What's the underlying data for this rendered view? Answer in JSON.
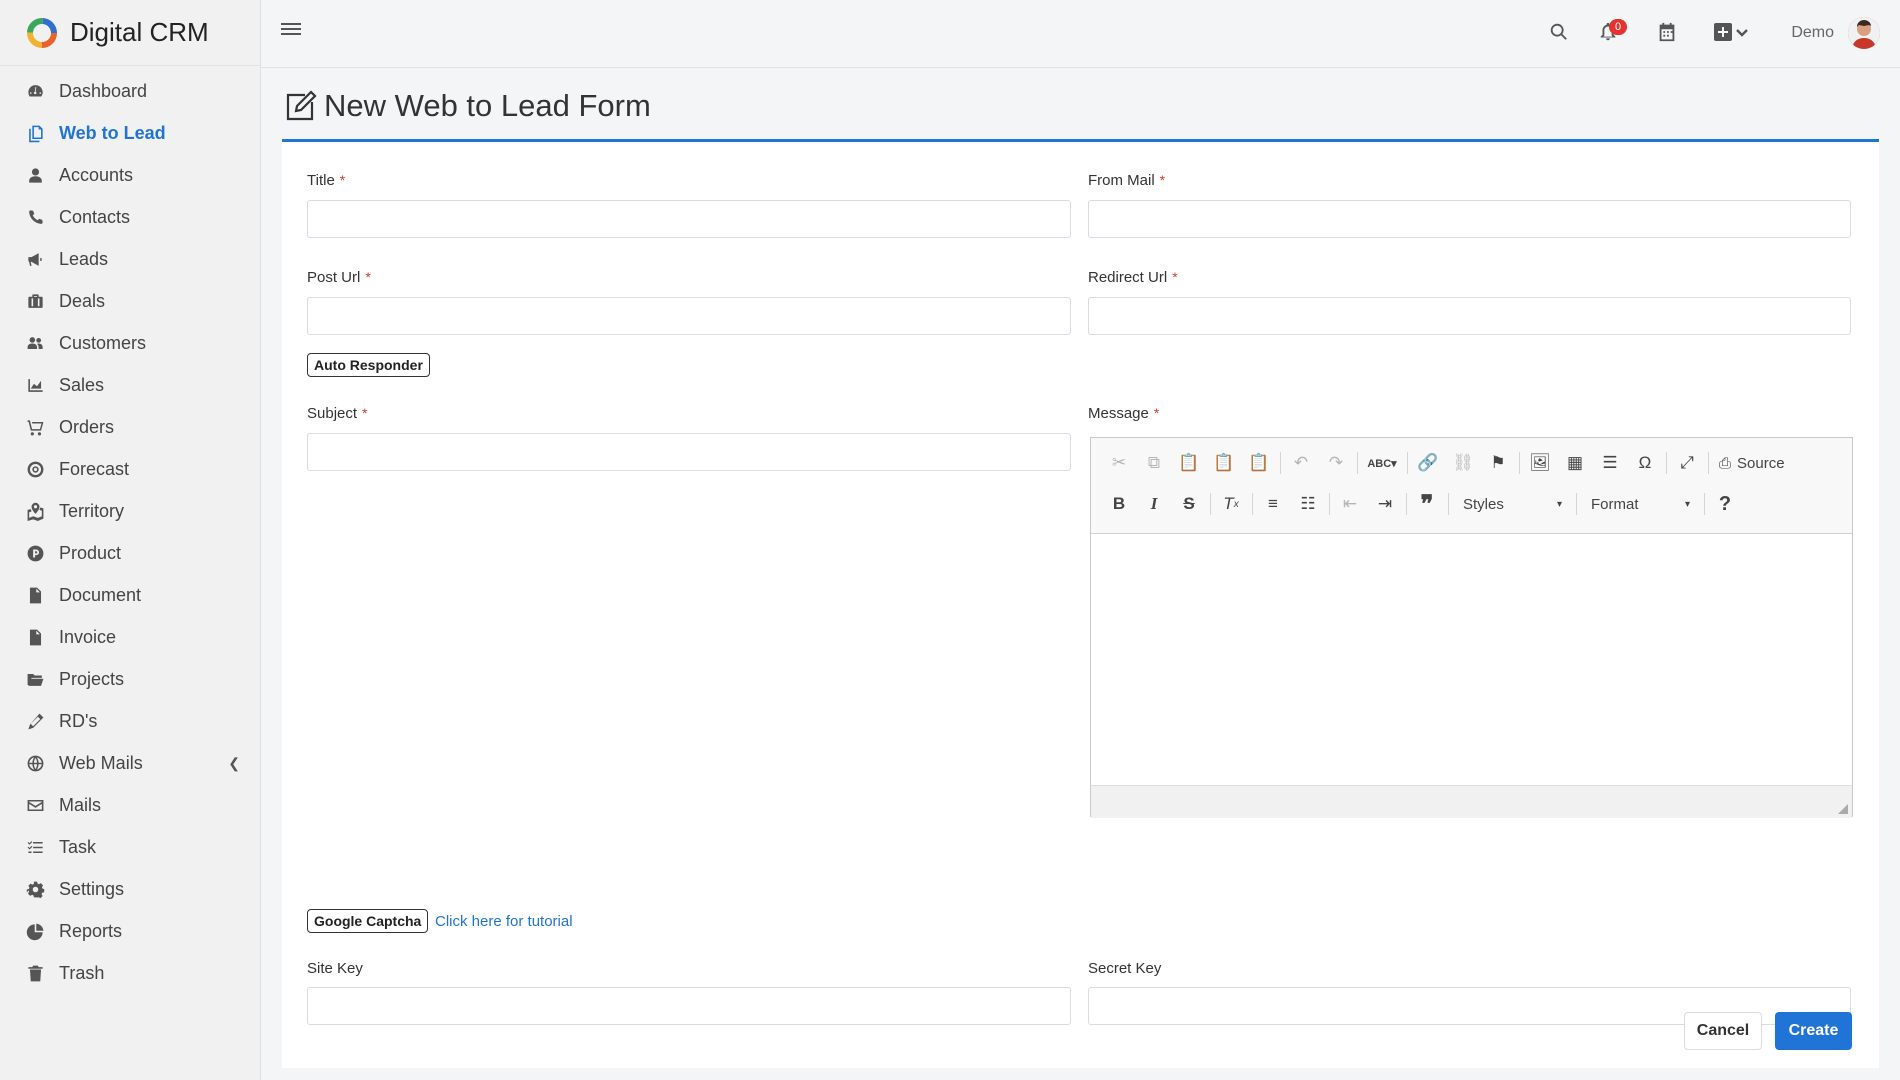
{
  "app": {
    "name": "Digital CRM"
  },
  "sidebar": {
    "items": [
      {
        "label": "Dashboard",
        "icon": "dashboard-icon",
        "active": false
      },
      {
        "label": "Web to Lead",
        "icon": "file-copy-icon",
        "active": true
      },
      {
        "label": "Accounts",
        "icon": "user-icon",
        "active": false
      },
      {
        "label": "Contacts",
        "icon": "phone-icon",
        "active": false
      },
      {
        "label": "Leads",
        "icon": "bullhorn-icon",
        "active": false
      },
      {
        "label": "Deals",
        "icon": "briefcase-icon",
        "active": false
      },
      {
        "label": "Customers",
        "icon": "users-icon",
        "active": false
      },
      {
        "label": "Sales",
        "icon": "area-chart-icon",
        "active": false
      },
      {
        "label": "Orders",
        "icon": "cart-icon",
        "active": false
      },
      {
        "label": "Forecast",
        "icon": "target-icon",
        "active": false
      },
      {
        "label": "Territory",
        "icon": "map-marked-icon",
        "active": false
      },
      {
        "label": "Product",
        "icon": "product-p-icon",
        "active": false
      },
      {
        "label": "Document",
        "icon": "document-icon",
        "active": false
      },
      {
        "label": "Invoice",
        "icon": "invoice-icon",
        "active": false
      },
      {
        "label": "Projects",
        "icon": "folder-open-icon",
        "active": false
      },
      {
        "label": "RD's",
        "icon": "pencil-icon",
        "active": false
      },
      {
        "label": "Web Mails",
        "icon": "globe-icon",
        "active": false
      },
      {
        "label": "Mails",
        "icon": "envelope-icon",
        "active": false
      },
      {
        "label": "Task",
        "icon": "tasks-icon",
        "active": false
      },
      {
        "label": "Settings",
        "icon": "gear-icon",
        "active": false
      },
      {
        "label": "Reports",
        "icon": "pie-chart-icon",
        "active": false
      },
      {
        "label": "Trash",
        "icon": "trash-icon",
        "active": false
      }
    ]
  },
  "header": {
    "notifications_count": "0",
    "user_name": "Demo"
  },
  "page": {
    "title": "New Web to Lead Form"
  },
  "form": {
    "title_label": "Title",
    "from_mail_label": "From Mail",
    "post_url_label": "Post Url",
    "redirect_url_label": "Redirect Url",
    "auto_responder_label": "Auto Responder",
    "subject_label": "Subject",
    "message_label": "Message",
    "google_captcha_label": "Google Captcha",
    "tutorial_link": "Click here for tutorial",
    "site_key_label": "Site Key",
    "secret_key_label": "Secret Key",
    "required_mark": "*",
    "cancel_label": "Cancel",
    "create_label": "Create"
  },
  "editor": {
    "source_label": "Source",
    "styles_label": "Styles",
    "format_label": "Format"
  },
  "colors": {
    "accent": "#1f74d6",
    "required": "#e3342f",
    "badge": "#e3342f"
  }
}
